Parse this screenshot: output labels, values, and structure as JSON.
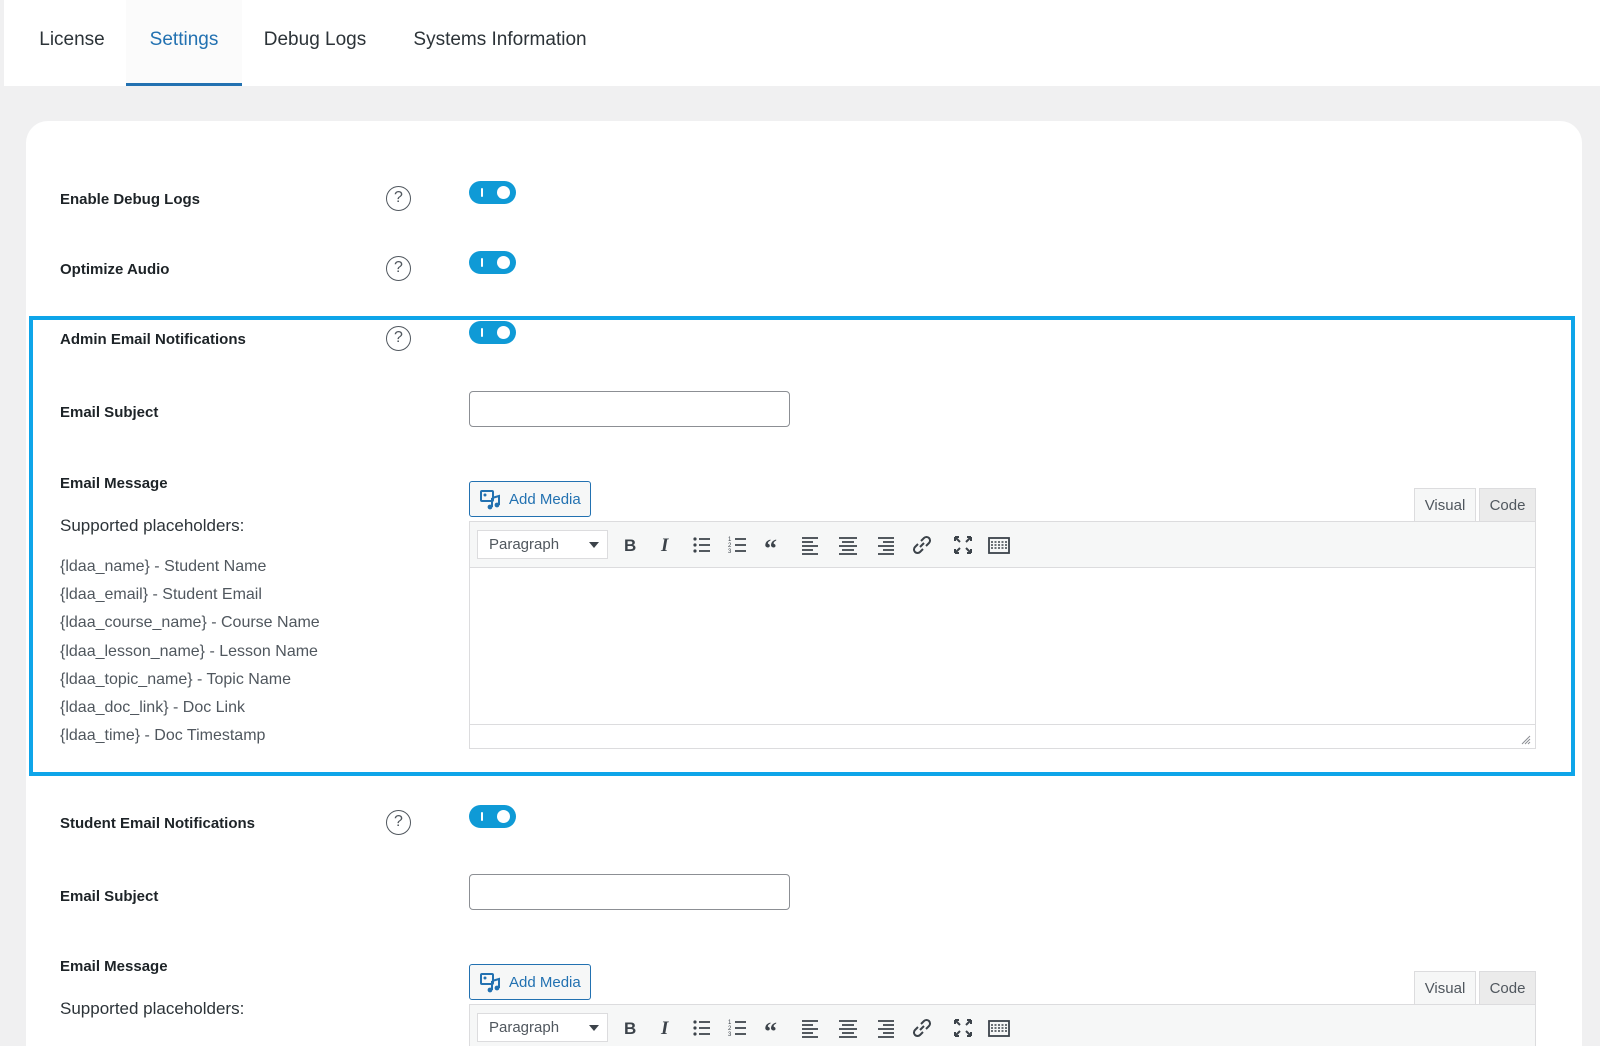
{
  "tabs": [
    {
      "label": "License"
    },
    {
      "label": "Settings"
    },
    {
      "label": "Debug Logs"
    },
    {
      "label": "Systems Information"
    }
  ],
  "active_tab": "Settings",
  "colors": {
    "accent": "#2271b1",
    "toggle_on": "#0f9ad6",
    "highlight": "#0ea5e9"
  },
  "settings": {
    "enable_debug_logs": {
      "label": "Enable Debug Logs",
      "help": "?",
      "enabled": true
    },
    "optimize_audio": {
      "label": "Optimize Audio",
      "help": "?",
      "enabled": true
    },
    "admin_notifications": {
      "label": "Admin Email Notifications",
      "help": "?",
      "enabled": true
    },
    "admin_email_subject": {
      "label": "Email Subject",
      "value": ""
    },
    "admin_email_message": {
      "label": "Email Message",
      "placeholders_heading": "Supported placeholders:",
      "placeholders": [
        "{ldaa_name} - Student Name",
        "{ldaa_email} - Student Email",
        "{ldaa_course_name} - Course Name",
        "{ldaa_lesson_name} - Lesson Name",
        "{ldaa_topic_name} - Topic Name",
        "{ldaa_doc_link} - Doc Link",
        "{ldaa_time} - Doc Timestamp"
      ]
    },
    "student_notifications": {
      "label": "Student Email Notifications",
      "help": "?",
      "enabled": true
    },
    "student_email_subject": {
      "label": "Email Subject",
      "value": ""
    },
    "student_email_message": {
      "label": "Email Message",
      "placeholders_heading": "Supported placeholders:"
    }
  },
  "editor": {
    "add_media": "Add Media",
    "tab_visual": "Visual",
    "tab_code": "Code",
    "format": "Paragraph",
    "toolbar_icons": [
      "bold-icon",
      "italic-icon",
      "bullet-list-icon",
      "numbered-list-icon",
      "blockquote-icon",
      "align-left-icon",
      "align-center-icon",
      "align-right-icon",
      "link-icon",
      "fullscreen-icon",
      "toolbar-toggle-icon"
    ]
  }
}
